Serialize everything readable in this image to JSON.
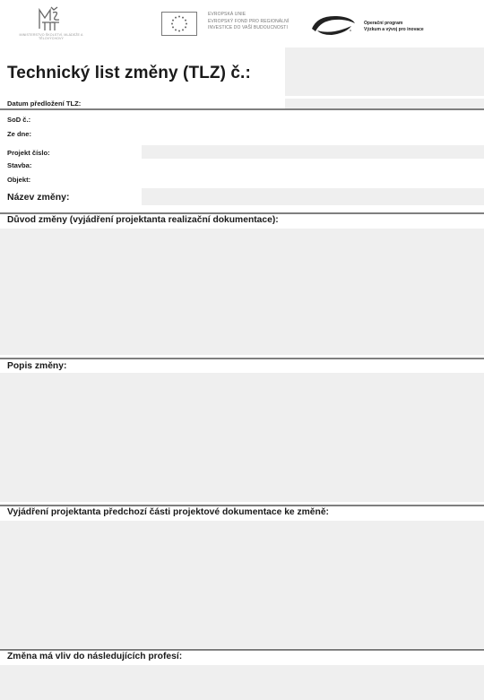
{
  "header": {
    "msmt_logo_text": "MŠMT",
    "msmt_caption": "MINISTERSTVO ŠKOLSTVÍ, MLÁDEŽE A TĚLOVÝCHOVY",
    "eu_lines": [
      "EVROPSKÁ UNIE",
      "EVROPSKÝ FOND PRO REGIONÁLNÍ",
      "INVESTICE DO VAŠÍ BUDOUCNOSTI"
    ],
    "op_lines": [
      "Operační program",
      "Výzkum a vývoj pro inovace"
    ]
  },
  "title": "Technický list změny (TLZ) č.:",
  "fields": {
    "submission_date": "Datum předložení TLZ:",
    "sod_number": "SoD č.:",
    "sod_date": "Ze dne:",
    "project_number": "Projekt číslo:",
    "construction": "Stavba:",
    "object": "Objekt:",
    "change_name": "Název změny:"
  },
  "sections": {
    "reason": "Důvod změny (vyjádření projektanta realizační dokumentace):",
    "description": "Popis změny:",
    "previous_designer": "Vyjádření projektanta předchozí části projektové dokumentace ke změně:",
    "professions": "Změna má vliv do následujících profesí:"
  },
  "colors": {
    "field_fill": "#efefef",
    "rule": "#7f7f7f",
    "text": "#1a1a1a"
  },
  "icons": {
    "eu_flag": "eu-flag-icon",
    "op_logo": "op-swoosh-icon"
  }
}
